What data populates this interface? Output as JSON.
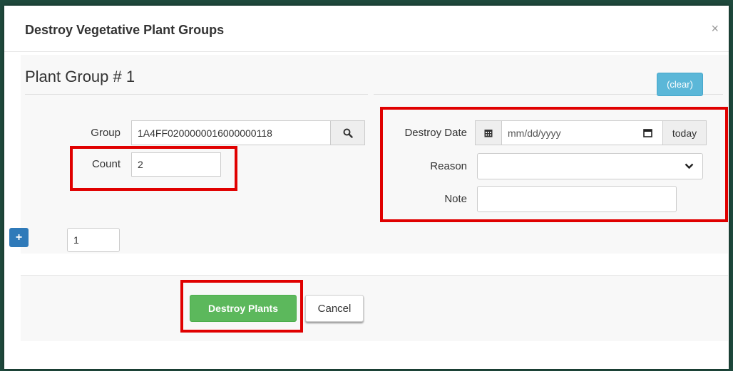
{
  "modal": {
    "title": "Destroy Vegetative Plant Groups",
    "close_glyph": "×"
  },
  "plant_group": {
    "title": "Plant Group # 1",
    "clear_label": "(clear)",
    "group_label": "Group",
    "group_value": "1A4FF0200000016000000118",
    "count_label": "Count",
    "count_value": "2",
    "destroy_date_label": "Destroy Date",
    "destroy_date_placeholder": "mm/dd/yyyy",
    "today_label": "today",
    "reason_label": "Reason",
    "reason_value": "",
    "note_label": "Note",
    "note_value": ""
  },
  "add_groups": {
    "plus_glyph": "+",
    "quantity": "1"
  },
  "footer": {
    "destroy_label": "Destroy Plants",
    "cancel_label": "Cancel"
  },
  "colors": {
    "highlight": "#e00000",
    "destroy_button": "#5cb85c",
    "clear_button": "#5bb7d8",
    "plus_button": "#2f7ab9"
  }
}
